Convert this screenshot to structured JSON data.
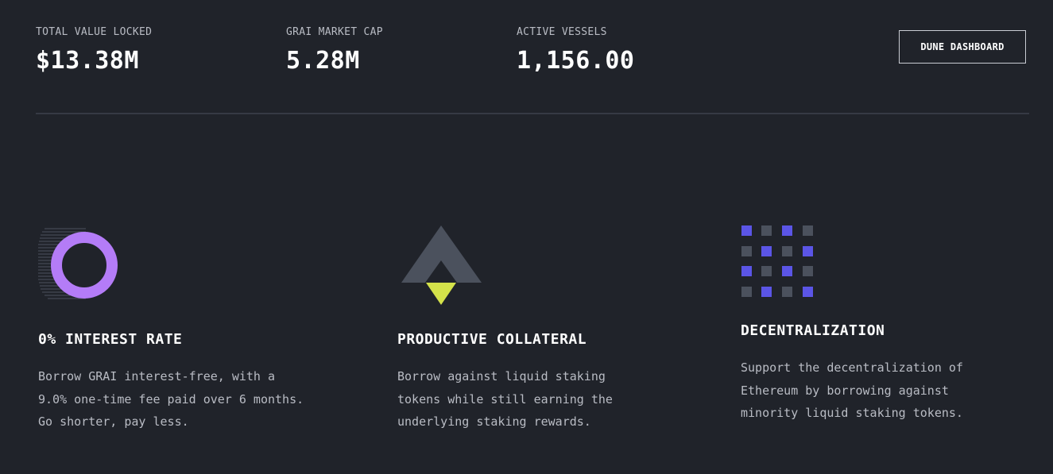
{
  "stats": {
    "tvl": {
      "label": "TOTAL VALUE LOCKED",
      "value": "$13.38M"
    },
    "market_cap": {
      "label": "GRAI MARKET CAP",
      "value": "5.28M"
    },
    "active_vessels": {
      "label": "ACTIVE VESSELS",
      "value": "1,156.00"
    }
  },
  "dune_button": {
    "label": "DUNE DASHBOARD"
  },
  "features": [
    {
      "title": "0% INTEREST RATE",
      "desc_lines": [
        "Borrow GRAI interest-free, with a",
        "9.0% one-time fee paid over 6 months.",
        "Go shorter, pay less."
      ],
      "icon": "ring-icon"
    },
    {
      "title": "PRODUCTIVE COLLATERAL",
      "desc_lines": [
        "Borrow against liquid staking",
        "tokens while still earning the",
        "underlying staking rewards."
      ],
      "icon": "arrow-up-icon"
    },
    {
      "title": "DECENTRALIZATION",
      "desc_lines": [
        "Support the decentralization of",
        "Ethereum by borrowing against",
        "minority liquid staking tokens."
      ],
      "icon": "grid-dots-icon"
    }
  ],
  "colors": {
    "background": "#20232a",
    "purple": "#b47cf7",
    "lime": "#d4e24a",
    "slate": "#4b515d",
    "indigo": "#5b55e6"
  }
}
